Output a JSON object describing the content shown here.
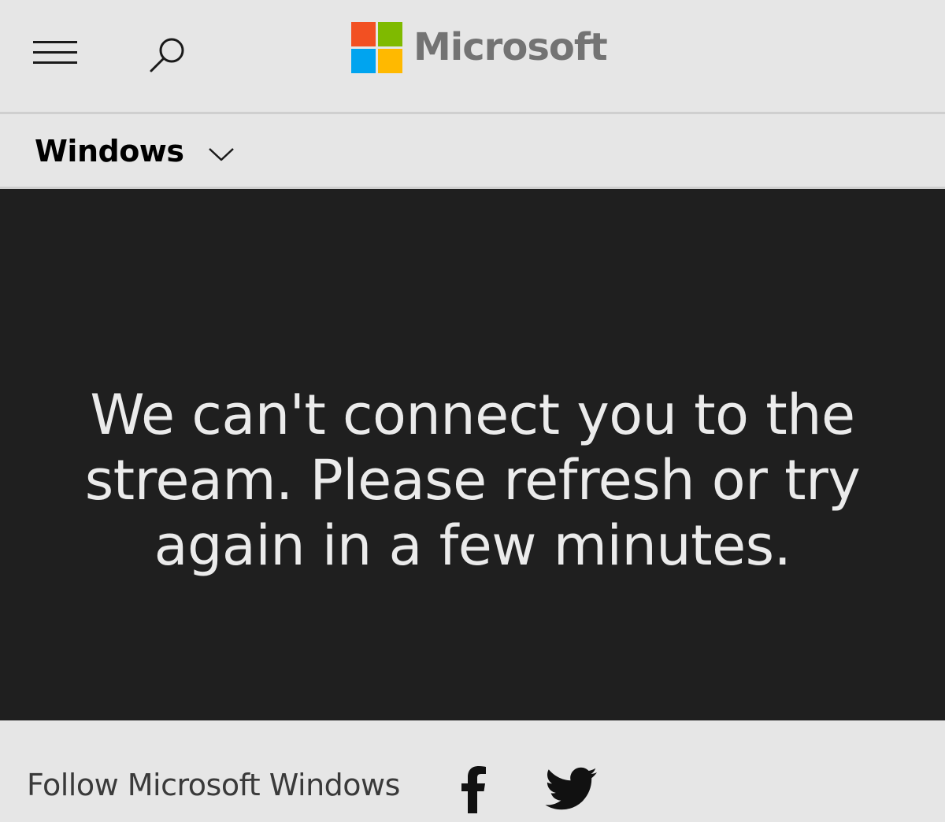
{
  "header": {
    "brand": "Microsoft",
    "logo_colors": [
      "#f25022",
      "#7fba00",
      "#00a4ef",
      "#ffb900"
    ],
    "menu_icon": "hamburger-icon",
    "search_icon": "search-icon"
  },
  "subnav": {
    "label": "Windows",
    "icon": "chevron-down-icon"
  },
  "stage": {
    "background": "#1f1f1f",
    "message": "We can't connect you to the stream. Please refresh or try again in a few minutes."
  },
  "footer": {
    "follow_text": "Follow Microsoft Windows",
    "social": [
      {
        "icon": "facebook-icon"
      },
      {
        "icon": "twitter-icon"
      }
    ]
  }
}
